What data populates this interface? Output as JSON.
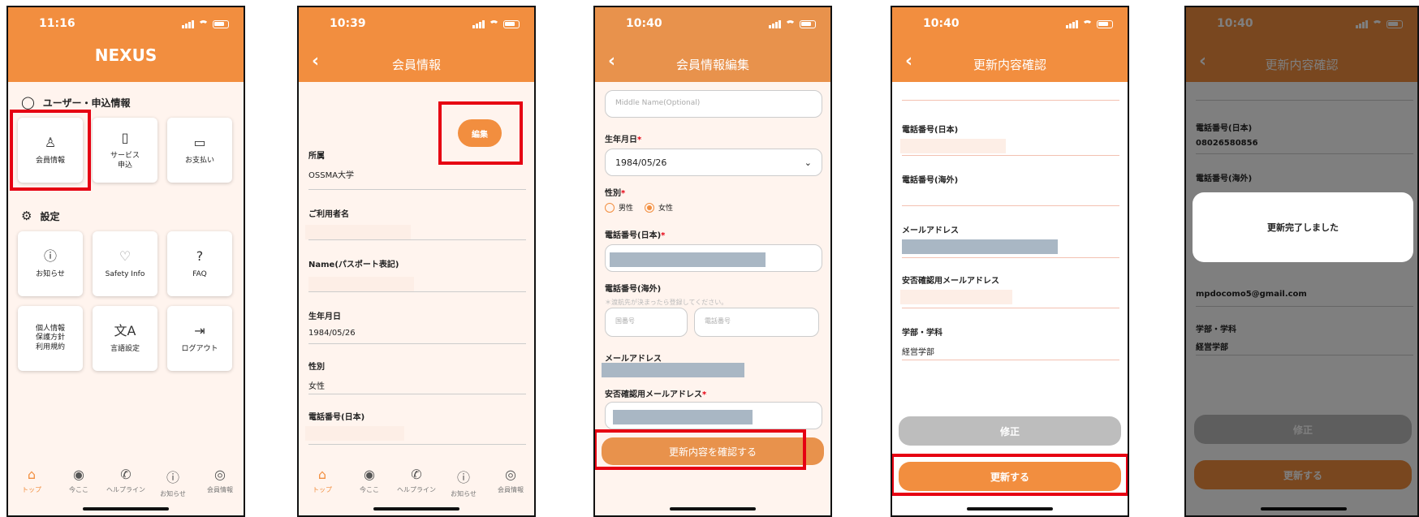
{
  "p1": {
    "time": "11:16",
    "app_title": "NEXUS",
    "sec_user": "ユーザー・申込情報",
    "sec_settings": "設定",
    "tiles": [
      "会員情報",
      "サービス\n申込",
      "お支払い",
      "お知らせ",
      "Safety Info",
      "FAQ",
      "個人情報\n保護方針\n利用規約",
      "言語設定",
      "ログアウト"
    ]
  },
  "nav": [
    "トップ",
    "今ここ",
    "ヘルプライン",
    "お知らせ",
    "会員情報"
  ],
  "p2": {
    "time": "10:39",
    "title": "会員情報",
    "edit": "編集",
    "fields": [
      {
        "label": "所属",
        "value": "OSSMA大学"
      },
      {
        "label": "ご利用者名",
        "value": ""
      },
      {
        "label": "Name(パスポート表記)",
        "value": ""
      },
      {
        "label": "生年月日",
        "value": "1984/05/26"
      },
      {
        "label": "性別",
        "value": "女性"
      },
      {
        "label": "電話番号(日本)",
        "value": ""
      }
    ]
  },
  "p3": {
    "time": "10:40",
    "title": "会員情報編集",
    "middle_ph": "Middle Name(Optional)",
    "birth_label": "生年月日",
    "birth": "1984/05/26",
    "sex_label": "性別",
    "male": "男性",
    "female": "女性",
    "tel_jp": "電話番号(日本)",
    "tel_ov": "電話番号(海外)",
    "tel_note": "＊渡航先が決まったら登録してください。",
    "country_ph": "国番号",
    "phone_ph": "電話番号",
    "mail": "メールアドレス",
    "safety_mail": "安否確認用メールアドレス",
    "confirm_btn": "更新内容を確認する"
  },
  "p4": {
    "time": "10:40",
    "title": "更新内容確認",
    "fields": [
      "電話番号(日本)",
      "電話番号(海外)",
      "メールアドレス",
      "安否確認用メールアドレス",
      "学部・学科"
    ],
    "dept": "経営学部",
    "fix": "修正",
    "update": "更新する"
  },
  "p5": {
    "time": "10:40",
    "title": "更新内容確認",
    "tel_jp_label": "電話番号(日本)",
    "tel_jp": "08026580856",
    "tel_ov_label": "電話番号(海外)",
    "dialog": "更新完了しました",
    "email": "mpdocomo5@gmail.com",
    "dept_label": "学部・学科",
    "dept": "経営学部",
    "fix": "修正",
    "update": "更新する"
  }
}
